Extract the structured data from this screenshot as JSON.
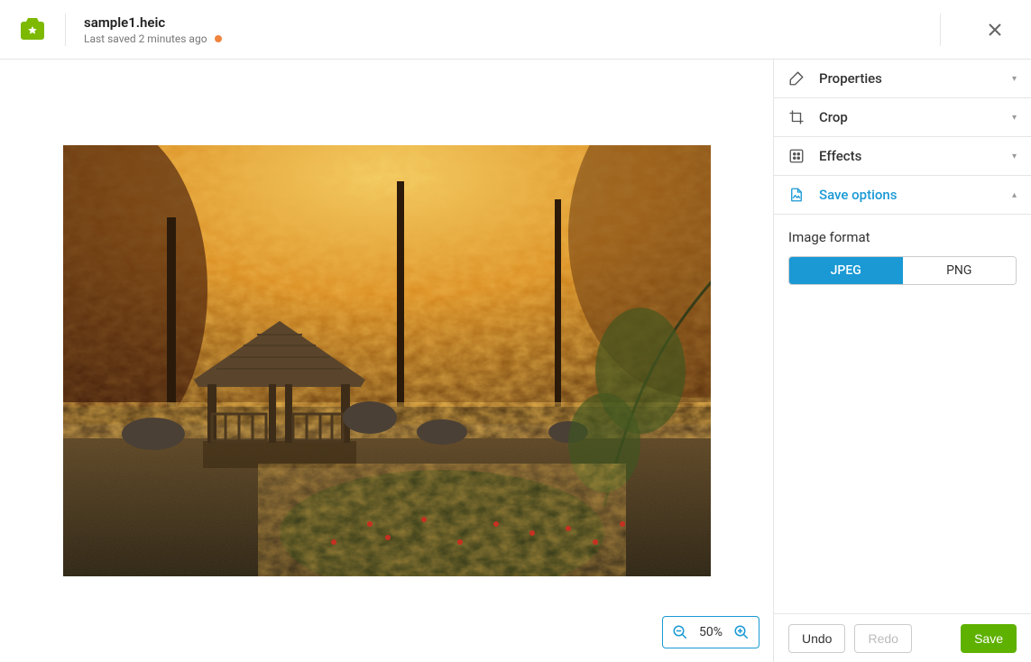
{
  "header": {
    "filename": "sample1.heic",
    "last_saved": "Last saved 2 minutes ago"
  },
  "zoom": {
    "level": "50%"
  },
  "panels": [
    {
      "key": "properties",
      "label": "Properties"
    },
    {
      "key": "crop",
      "label": "Crop"
    },
    {
      "key": "effects",
      "label": "Effects"
    },
    {
      "key": "save",
      "label": "Save options"
    }
  ],
  "save_options": {
    "section_label": "Image format",
    "formats": {
      "jpeg": "JPEG",
      "png": "PNG"
    }
  },
  "footer": {
    "undo": "Undo",
    "redo": "Redo",
    "save": "Save"
  }
}
